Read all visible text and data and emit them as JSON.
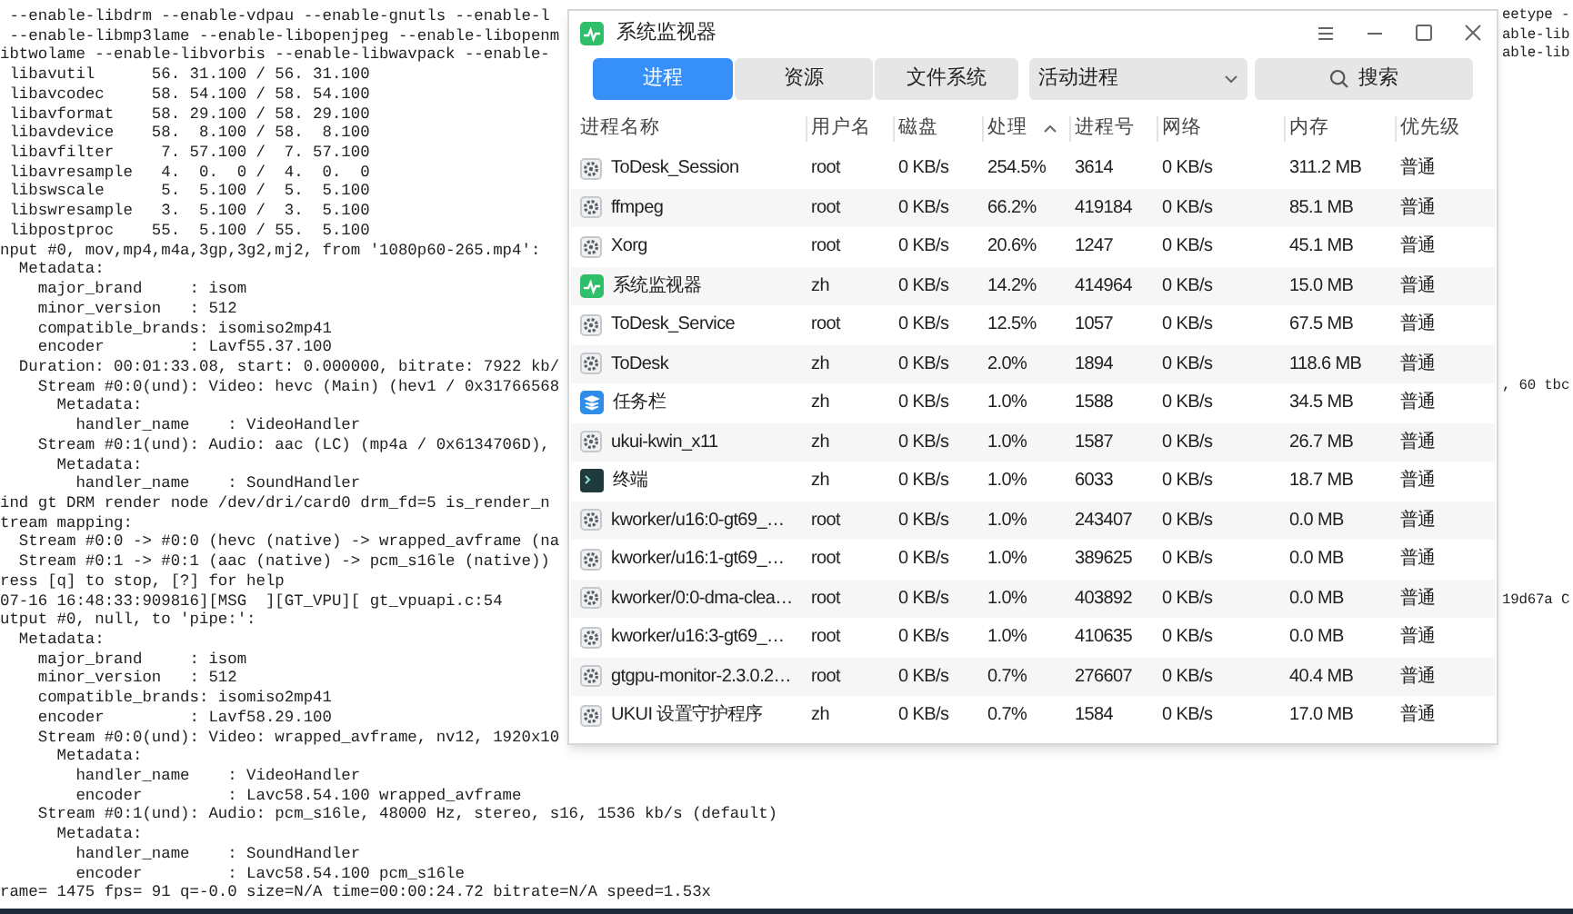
{
  "terminal": {
    "lines": [
      {
        "text": " --enable-libdrm --enable-vdpau --enable-gnutls --enable-l",
        "right": "eetype -"
      },
      {
        "text": " --enable-libmp3lame --enable-libopenjpeg --enable-libopenm",
        "right": "able-lib"
      },
      {
        "text": "ibtwolame --enable-libvorbis --enable-libwavpack --enable-",
        "right": "able-lib"
      },
      {
        "text": " libavutil      56. 31.100 / 56. 31.100"
      },
      {
        "text": " libavcodec     58. 54.100 / 58. 54.100"
      },
      {
        "text": " libavformat    58. 29.100 / 58. 29.100"
      },
      {
        "text": " libavdevice    58.  8.100 / 58.  8.100"
      },
      {
        "text": " libavfilter     7. 57.100 /  7. 57.100"
      },
      {
        "text": " libavresample   4.  0.  0 /  4.  0.  0"
      },
      {
        "text": " libswscale      5.  5.100 /  5.  5.100"
      },
      {
        "text": " libswresample   3.  5.100 /  3.  5.100"
      },
      {
        "text": " libpostproc    55.  5.100 / 55.  5.100"
      },
      {
        "text": "nput #0, mov,mp4,m4a,3gp,3g2,mj2, from '1080p60-265.mp4':"
      },
      {
        "text": "  Metadata:"
      },
      {
        "text": "    major_brand     : isom"
      },
      {
        "text": "    minor_version   : 512"
      },
      {
        "text": "    compatible_brands: isomiso2mp41"
      },
      {
        "text": "    encoder         : Lavf55.37.100"
      },
      {
        "text": "  Duration: 00:01:33.08, start: 0.000000, bitrate: 7922 kb/"
      },
      {
        "text": "    Stream #0:0(und): Video: hevc (Main) (hev1 / 0x31766568",
        "right": ", 60 tbc"
      },
      {
        "text": "      Metadata:"
      },
      {
        "text": "        handler_name    : VideoHandler"
      },
      {
        "text": "    Stream #0:1(und): Audio: aac (LC) (mp4a / 0x6134706D),"
      },
      {
        "text": "      Metadata:"
      },
      {
        "text": "        handler_name    : SoundHandler"
      },
      {
        "text": "ind gt DRM render node /dev/dri/card0 drm_fd=5 is_render_n"
      },
      {
        "text": "tream mapping:"
      },
      {
        "text": "  Stream #0:0 -> #0:0 (hevc (native) -> wrapped_avframe (na"
      },
      {
        "text": "  Stream #0:1 -> #0:1 (aac (native) -> pcm_s16le (native))"
      },
      {
        "text": "ress [q] to stop, [?] for help"
      },
      {
        "text": "07-16 16:48:33:909816][MSG  ][GT_VPU][ gt_vpuapi.c:54",
        "right": "19d67a C"
      },
      {
        "text": "utput #0, null, to 'pipe:':"
      },
      {
        "text": "  Metadata:"
      },
      {
        "text": "    major_brand     : isom"
      },
      {
        "text": "    minor_version   : 512"
      },
      {
        "text": "    compatible_brands: isomiso2mp41"
      },
      {
        "text": "    encoder         : Lavf58.29.100"
      },
      {
        "text": "    Stream #0:0(und): Video: wrapped_avframe, nv12, 1920x10"
      },
      {
        "text": "      Metadata:"
      },
      {
        "text": "        handler_name    : VideoHandler"
      },
      {
        "text": "        encoder         : Lavc58.54.100 wrapped_avframe"
      },
      {
        "text": "    Stream #0:1(und): Audio: pcm_s16le, 48000 Hz, stereo, s16, 1536 kb/s (default)"
      },
      {
        "text": "      Metadata:"
      },
      {
        "text": "        handler_name    : SoundHandler"
      },
      {
        "text": "        encoder         : Lavc58.54.100 pcm_s16le"
      },
      {
        "text": "rame= 1475 fps= 91 q=-0.0 size=N/A time=00:00:24.72 bitrate=N/A speed=1.53x"
      }
    ]
  },
  "window": {
    "title": "系统监视器",
    "tabs": [
      {
        "label": "进程",
        "selected": true
      },
      {
        "label": "资源",
        "selected": false
      },
      {
        "label": "文件系统",
        "selected": false
      }
    ],
    "filter": {
      "value": "活动进程"
    },
    "search": {
      "label": "搜索"
    },
    "table": {
      "columns": [
        "进程名称",
        "用户名",
        "磁盘",
        "处理",
        "进程号",
        "网络",
        "内存",
        "优先级"
      ],
      "rows": [
        {
          "kind": "gear",
          "cells": [
            "ToDesk_Session",
            "root",
            "0 KB/s",
            "254.5%",
            "3614",
            "0 KB/s",
            "311.2 MB",
            "普通"
          ]
        },
        {
          "kind": "gear",
          "cells": [
            "ffmpeg",
            "root",
            "0 KB/s",
            "66.2%",
            "419184",
            "0 KB/s",
            "85.1 MB",
            "普通"
          ]
        },
        {
          "kind": "gear",
          "cells": [
            "Xorg",
            "root",
            "0 KB/s",
            "20.6%",
            "1247",
            "0 KB/s",
            "45.1 MB",
            "普通"
          ]
        },
        {
          "kind": "monitor",
          "cells": [
            "系统监视器",
            "zh",
            "0 KB/s",
            "14.2%",
            "414964",
            "0 KB/s",
            "15.0 MB",
            "普通"
          ]
        },
        {
          "kind": "gear",
          "cells": [
            "ToDesk_Service",
            "root",
            "0 KB/s",
            "12.5%",
            "1057",
            "0 KB/s",
            "67.5 MB",
            "普通"
          ]
        },
        {
          "kind": "gear",
          "cells": [
            "ToDesk",
            "zh",
            "0 KB/s",
            "2.0%",
            "1894",
            "0 KB/s",
            "118.6 MB",
            "普通"
          ]
        },
        {
          "kind": "stack",
          "cells": [
            "任务栏",
            "zh",
            "0 KB/s",
            "1.0%",
            "1588",
            "0 KB/s",
            "34.5 MB",
            "普通"
          ]
        },
        {
          "kind": "gear",
          "cells": [
            "ukui-kwin_x11",
            "zh",
            "0 KB/s",
            "1.0%",
            "1587",
            "0 KB/s",
            "26.7 MB",
            "普通"
          ]
        },
        {
          "kind": "terminal",
          "cells": [
            "终端",
            "zh",
            "0 KB/s",
            "1.0%",
            "6033",
            "0 KB/s",
            "18.7 MB",
            "普通"
          ]
        },
        {
          "kind": "gear",
          "cells": [
            "kworker/u16:0-gt69_…",
            "root",
            "0 KB/s",
            "1.0%",
            "243407",
            "0 KB/s",
            "0.0 MB",
            "普通"
          ]
        },
        {
          "kind": "gear",
          "cells": [
            "kworker/u16:1-gt69_…",
            "root",
            "0 KB/s",
            "1.0%",
            "389625",
            "0 KB/s",
            "0.0 MB",
            "普通"
          ]
        },
        {
          "kind": "gear",
          "cells": [
            "kworker/0:0-dma-clea…",
            "root",
            "0 KB/s",
            "1.0%",
            "403892",
            "0 KB/s",
            "0.0 MB",
            "普通"
          ]
        },
        {
          "kind": "gear",
          "cells": [
            "kworker/u16:3-gt69_…",
            "root",
            "0 KB/s",
            "1.0%",
            "410635",
            "0 KB/s",
            "0.0 MB",
            "普通"
          ]
        },
        {
          "kind": "gear",
          "cells": [
            "gtgpu-monitor-2.3.0.2…",
            "root",
            "0 KB/s",
            "0.7%",
            "276607",
            "0 KB/s",
            "40.4 MB",
            "普通"
          ]
        },
        {
          "kind": "gear",
          "cells": [
            "UKUI 设置守护程序",
            "zh",
            "0 KB/s",
            "0.7%",
            "1584",
            "0 KB/s",
            "17.0 MB",
            "普通"
          ]
        }
      ]
    }
  }
}
